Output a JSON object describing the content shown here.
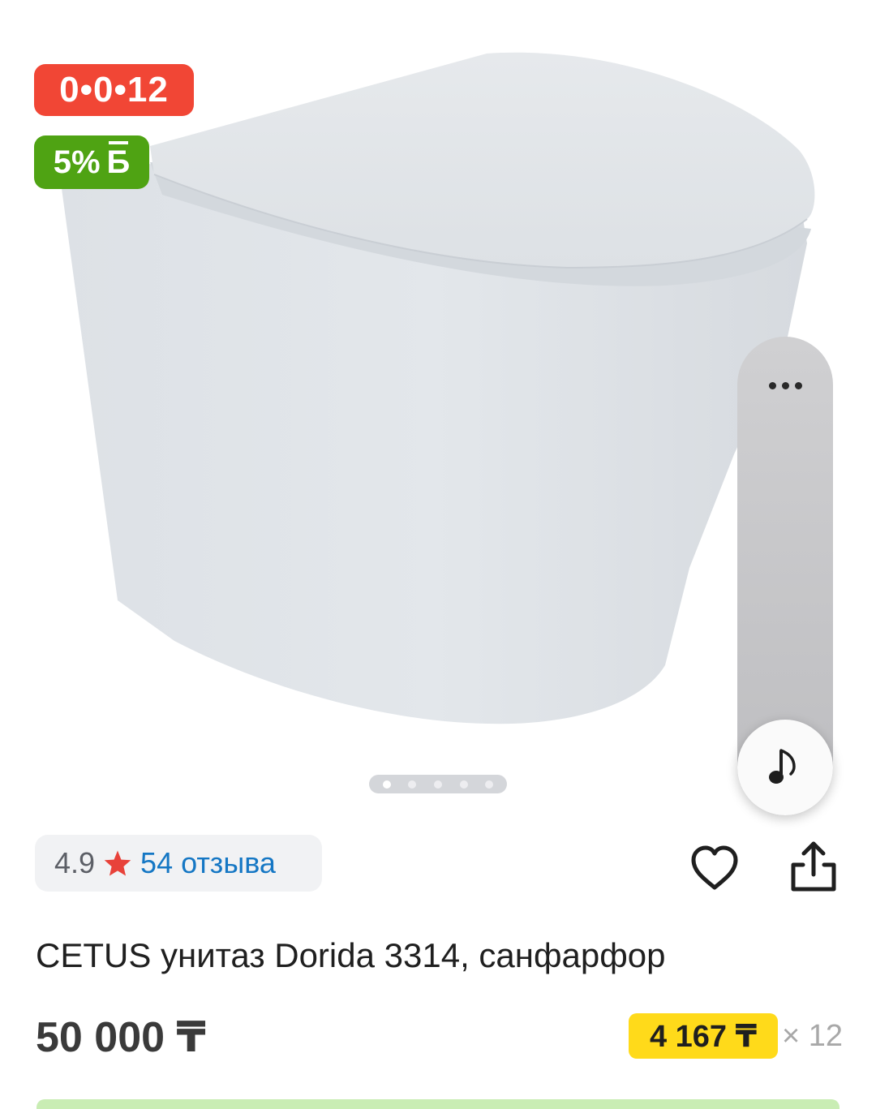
{
  "badges": {
    "installment": "0•0•12",
    "bonus_percent": "5%",
    "bonus_symbol": "Б"
  },
  "gallery": {
    "image_subject": "wall-hung toilet",
    "pages_total": 5,
    "active_page": 1
  },
  "side_panel": {
    "more_icon": "more-dots-icon",
    "music_icon": "music-note-icon"
  },
  "rating": {
    "value": "4.9",
    "star_icon": "star-icon",
    "reviews": "54 отзыва"
  },
  "actions": {
    "favorite_icon": "heart-icon",
    "share_icon": "share-icon"
  },
  "product": {
    "title": "CETUS унитаз Dorida 3314, санфарфор",
    "price": "50 000 ₸",
    "monthly_payment": "4 167 ₸",
    "months": "× 12"
  },
  "colors": {
    "installment_badge": "#f14635",
    "bonus_badge": "#4fa313",
    "monthly_badge": "#ffda1a",
    "link": "#1577c4",
    "star": "#e8423a"
  }
}
